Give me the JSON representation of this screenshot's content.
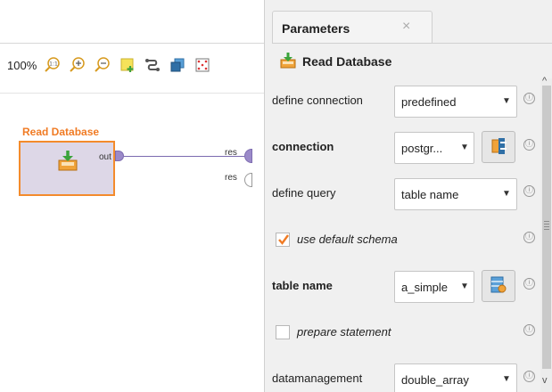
{
  "canvas": {
    "zoom": "100%",
    "toolbar_icons": [
      "zoom-fit-icon",
      "zoom-in-icon",
      "zoom-out-icon",
      "add-note-icon",
      "auto-wire-icon",
      "layers-icon",
      "fit-view-icon"
    ],
    "operator": {
      "title": "Read Database",
      "out_port": "out"
    },
    "result_ports": [
      "res",
      "res"
    ],
    "colors": {
      "operator_border": "#f38b2c",
      "operator_fill": "#ddd7e7",
      "wire": "#7b6ab0"
    }
  },
  "panel": {
    "tab_label": "Parameters",
    "tab_close": "×",
    "operator_name": "Read Database",
    "info_glyph": "ⓘ",
    "scroll_up": "^",
    "scroll_down": "v",
    "params": {
      "define_connection": {
        "label": "define connection",
        "value": "predefined"
      },
      "connection": {
        "label": "connection",
        "value": "postgr..."
      },
      "define_query": {
        "label": "define query",
        "value": "table name"
      },
      "use_default_schema": {
        "label": "use default schema",
        "checked": true
      },
      "table_name": {
        "label": "table name",
        "value": "a_simple"
      },
      "prepare_statement": {
        "label": "prepare statement",
        "checked": false
      },
      "datamanagement": {
        "label": "datamanagement",
        "value": "double_array"
      }
    },
    "dropdown_arrow": "▼",
    "checkbox_color": "#f07b24"
  }
}
